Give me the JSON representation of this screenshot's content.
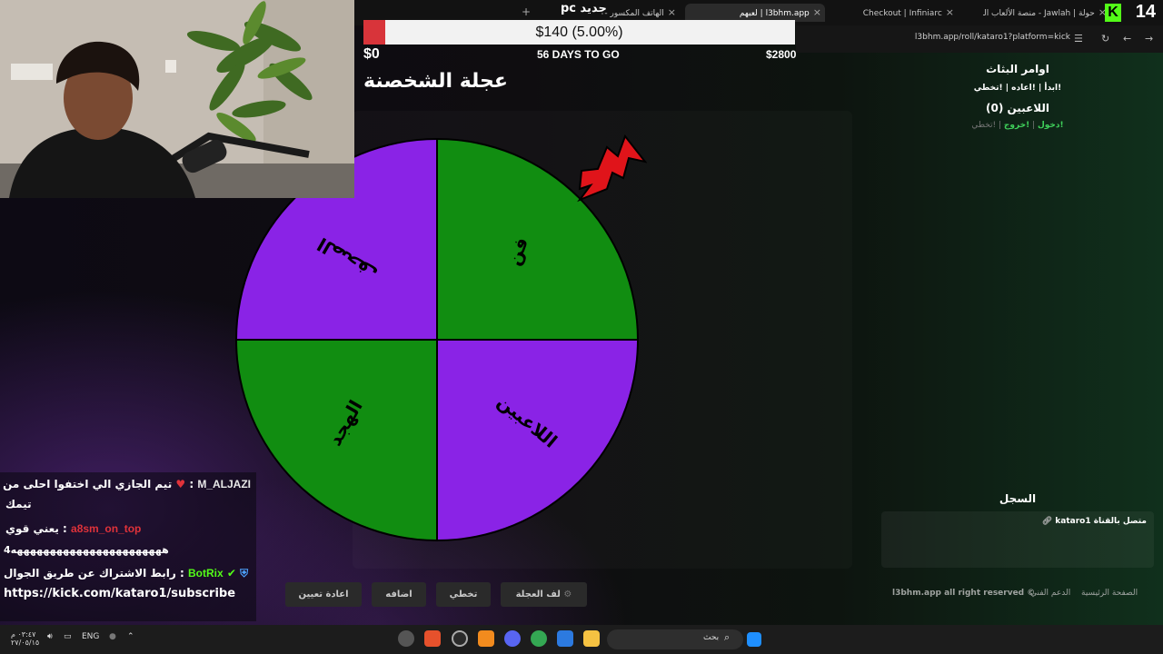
{
  "browser": {
    "tabs": [
      {
        "label": "حولة | Jawlah - منصة الألعاب الـ",
        "active": false
      },
      {
        "label": "Checkout | Infiniarc",
        "active": false
      },
      {
        "label": "l3bhm.app | لعبهم",
        "active": true
      },
      {
        "label": "الهاتف المكسور -",
        "active": false
      }
    ],
    "overlay_label": "pc جديد",
    "address": "l3bhm.app/roll/kataro1?platform=kick",
    "kick_logo": "K",
    "kick_count": "14"
  },
  "donation_goal": {
    "text": "$140 (5.00%)",
    "progress": 0.05,
    "min": "$0",
    "days_left": "56 DAYS TO GO",
    "max": "$2800",
    "fill_color": "#d8343a"
  },
  "page": {
    "title": "عجلة الشخصنة"
  },
  "wheel": {
    "segments": [
      {
        "label": "فن",
        "color": "#118d11"
      },
      {
        "label": "اللاعبين",
        "color": "#8a23e6"
      },
      {
        "label": "الهجد",
        "color": "#118d11"
      },
      {
        "label": "الصحف",
        "color": "#8a23e6"
      }
    ]
  },
  "commands": {
    "title": "اوامر البثاث",
    "list": "!ابدأ | !اعاده | !تخطي",
    "players_title": "اللاعبين (0)",
    "join": "!دخول",
    "leave": "!خروج",
    "skip": "!تخطي"
  },
  "log": {
    "title": "السجل",
    "entry": "متصل بالقناة kataro1"
  },
  "buttons": {
    "spin": "لف العجلة",
    "skip": "تخطي",
    "add": "اضافه",
    "reset": "اعادة تعيين"
  },
  "footer": {
    "copyright": "l3bhm.app all right reserved ©",
    "support": "الدعم الفني",
    "home": "الصفحة الرئيسية"
  },
  "chat": [
    {
      "user": "M_ALJAZI",
      "message": "تيم الجازي الي اختفوا احلى من",
      "message2": "تيمك",
      "user_color": "#e8e8e8"
    },
    {
      "user": "a8sm_on_top",
      "message": "يعني قوي",
      "user_color": "#e0323a"
    },
    {
      "user": "",
      "message": "هههههههههههههههههههههههه4",
      "user_color": "#ffffff"
    },
    {
      "user": "BotRix",
      "message": "رابط الاشتراك عن طريق الجوال",
      "user_color": "#53fc18"
    }
  ],
  "chat_link": "https://kick.com/kataro1/subscribe",
  "taskbar": {
    "search_placeholder": "بحث",
    "language": "ENG",
    "time": "٠٣:٤٧ م",
    "date": "٢٧/٠٥/١٥"
  },
  "accent_colors": {
    "green": "#118d11",
    "purple": "#8a23e6",
    "kick": "#53fc18"
  }
}
